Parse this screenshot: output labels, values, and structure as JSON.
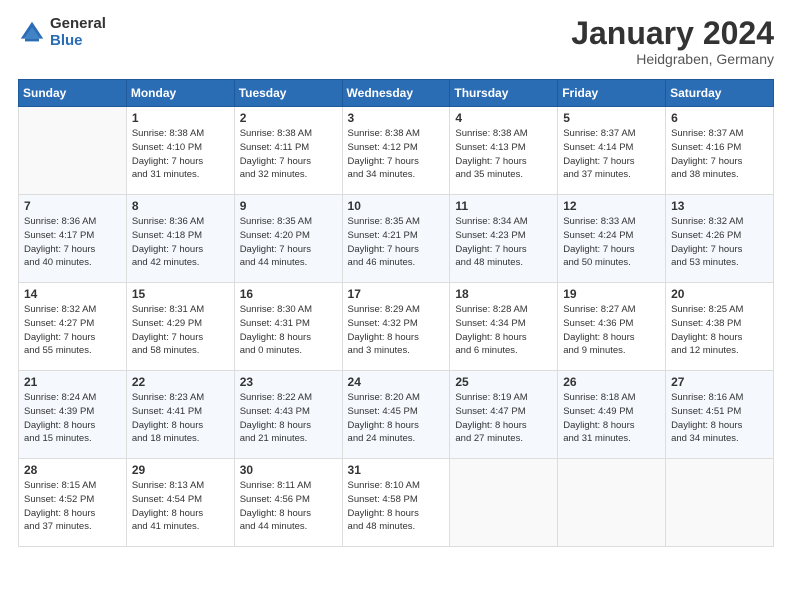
{
  "logo": {
    "general": "General",
    "blue": "Blue"
  },
  "header": {
    "month": "January 2024",
    "location": "Heidgraben, Germany"
  },
  "weekdays": [
    "Sunday",
    "Monday",
    "Tuesday",
    "Wednesday",
    "Thursday",
    "Friday",
    "Saturday"
  ],
  "weeks": [
    [
      {
        "day": "",
        "info": ""
      },
      {
        "day": "1",
        "info": "Sunrise: 8:38 AM\nSunset: 4:10 PM\nDaylight: 7 hours\nand 31 minutes."
      },
      {
        "day": "2",
        "info": "Sunrise: 8:38 AM\nSunset: 4:11 PM\nDaylight: 7 hours\nand 32 minutes."
      },
      {
        "day": "3",
        "info": "Sunrise: 8:38 AM\nSunset: 4:12 PM\nDaylight: 7 hours\nand 34 minutes."
      },
      {
        "day": "4",
        "info": "Sunrise: 8:38 AM\nSunset: 4:13 PM\nDaylight: 7 hours\nand 35 minutes."
      },
      {
        "day": "5",
        "info": "Sunrise: 8:37 AM\nSunset: 4:14 PM\nDaylight: 7 hours\nand 37 minutes."
      },
      {
        "day": "6",
        "info": "Sunrise: 8:37 AM\nSunset: 4:16 PM\nDaylight: 7 hours\nand 38 minutes."
      }
    ],
    [
      {
        "day": "7",
        "info": "Sunrise: 8:36 AM\nSunset: 4:17 PM\nDaylight: 7 hours\nand 40 minutes."
      },
      {
        "day": "8",
        "info": "Sunrise: 8:36 AM\nSunset: 4:18 PM\nDaylight: 7 hours\nand 42 minutes."
      },
      {
        "day": "9",
        "info": "Sunrise: 8:35 AM\nSunset: 4:20 PM\nDaylight: 7 hours\nand 44 minutes."
      },
      {
        "day": "10",
        "info": "Sunrise: 8:35 AM\nSunset: 4:21 PM\nDaylight: 7 hours\nand 46 minutes."
      },
      {
        "day": "11",
        "info": "Sunrise: 8:34 AM\nSunset: 4:23 PM\nDaylight: 7 hours\nand 48 minutes."
      },
      {
        "day": "12",
        "info": "Sunrise: 8:33 AM\nSunset: 4:24 PM\nDaylight: 7 hours\nand 50 minutes."
      },
      {
        "day": "13",
        "info": "Sunrise: 8:32 AM\nSunset: 4:26 PM\nDaylight: 7 hours\nand 53 minutes."
      }
    ],
    [
      {
        "day": "14",
        "info": "Sunrise: 8:32 AM\nSunset: 4:27 PM\nDaylight: 7 hours\nand 55 minutes."
      },
      {
        "day": "15",
        "info": "Sunrise: 8:31 AM\nSunset: 4:29 PM\nDaylight: 7 hours\nand 58 minutes."
      },
      {
        "day": "16",
        "info": "Sunrise: 8:30 AM\nSunset: 4:31 PM\nDaylight: 8 hours\nand 0 minutes."
      },
      {
        "day": "17",
        "info": "Sunrise: 8:29 AM\nSunset: 4:32 PM\nDaylight: 8 hours\nand 3 minutes."
      },
      {
        "day": "18",
        "info": "Sunrise: 8:28 AM\nSunset: 4:34 PM\nDaylight: 8 hours\nand 6 minutes."
      },
      {
        "day": "19",
        "info": "Sunrise: 8:27 AM\nSunset: 4:36 PM\nDaylight: 8 hours\nand 9 minutes."
      },
      {
        "day": "20",
        "info": "Sunrise: 8:25 AM\nSunset: 4:38 PM\nDaylight: 8 hours\nand 12 minutes."
      }
    ],
    [
      {
        "day": "21",
        "info": "Sunrise: 8:24 AM\nSunset: 4:39 PM\nDaylight: 8 hours\nand 15 minutes."
      },
      {
        "day": "22",
        "info": "Sunrise: 8:23 AM\nSunset: 4:41 PM\nDaylight: 8 hours\nand 18 minutes."
      },
      {
        "day": "23",
        "info": "Sunrise: 8:22 AM\nSunset: 4:43 PM\nDaylight: 8 hours\nand 21 minutes."
      },
      {
        "day": "24",
        "info": "Sunrise: 8:20 AM\nSunset: 4:45 PM\nDaylight: 8 hours\nand 24 minutes."
      },
      {
        "day": "25",
        "info": "Sunrise: 8:19 AM\nSunset: 4:47 PM\nDaylight: 8 hours\nand 27 minutes."
      },
      {
        "day": "26",
        "info": "Sunrise: 8:18 AM\nSunset: 4:49 PM\nDaylight: 8 hours\nand 31 minutes."
      },
      {
        "day": "27",
        "info": "Sunrise: 8:16 AM\nSunset: 4:51 PM\nDaylight: 8 hours\nand 34 minutes."
      }
    ],
    [
      {
        "day": "28",
        "info": "Sunrise: 8:15 AM\nSunset: 4:52 PM\nDaylight: 8 hours\nand 37 minutes."
      },
      {
        "day": "29",
        "info": "Sunrise: 8:13 AM\nSunset: 4:54 PM\nDaylight: 8 hours\nand 41 minutes."
      },
      {
        "day": "30",
        "info": "Sunrise: 8:11 AM\nSunset: 4:56 PM\nDaylight: 8 hours\nand 44 minutes."
      },
      {
        "day": "31",
        "info": "Sunrise: 8:10 AM\nSunset: 4:58 PM\nDaylight: 8 hours\nand 48 minutes."
      },
      {
        "day": "",
        "info": ""
      },
      {
        "day": "",
        "info": ""
      },
      {
        "day": "",
        "info": ""
      }
    ]
  ]
}
